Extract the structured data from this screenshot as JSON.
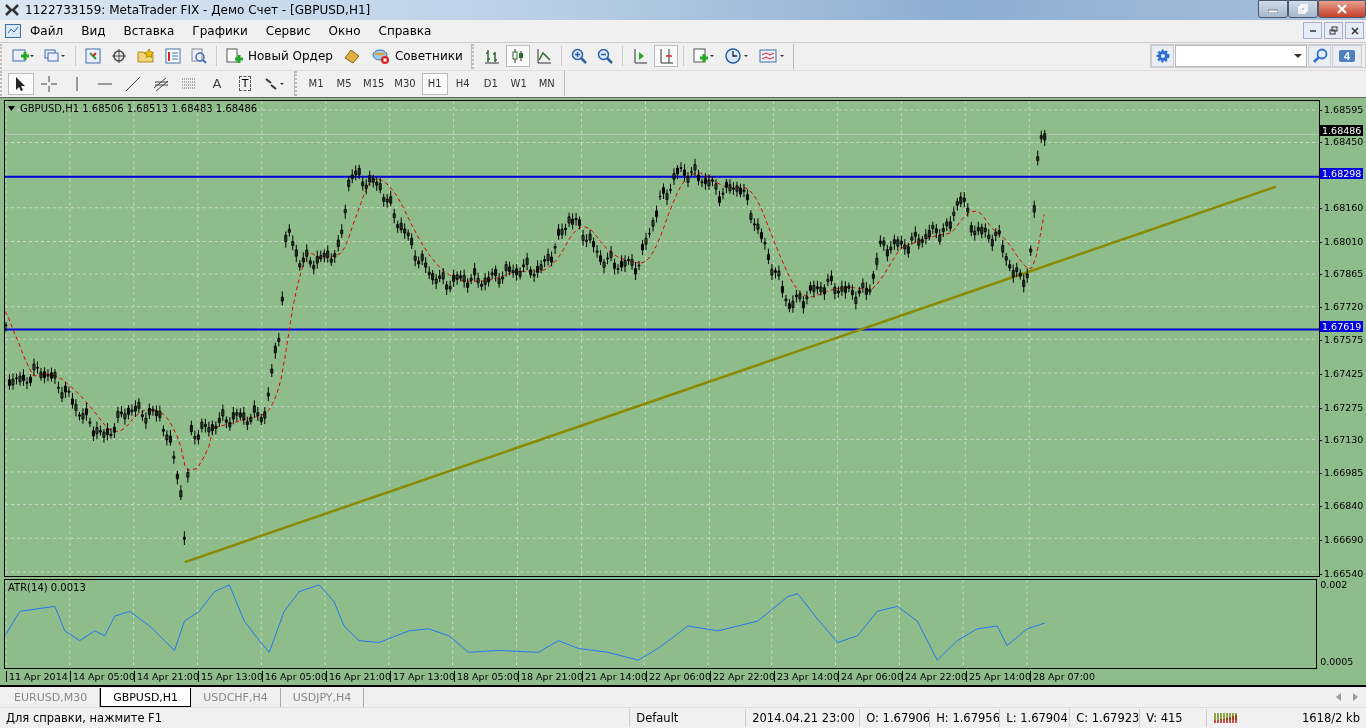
{
  "window": {
    "title": "1122733159: MetaTrader FIX - Демо Счет - [GBPUSD,H1]"
  },
  "menu": [
    "Файл",
    "Вид",
    "Вставка",
    "Графики",
    "Сервис",
    "Окно",
    "Справка"
  ],
  "toolbar": {
    "new_order": "Новый Ордер",
    "experts": "Советники",
    "notifications": "4"
  },
  "tools": [
    {
      "kind": "cursor",
      "selected": true
    },
    {
      "kind": "crosshair",
      "selected": false
    },
    {
      "kind": "vline",
      "selected": false
    },
    {
      "kind": "hline",
      "selected": false
    },
    {
      "kind": "trend",
      "selected": false
    },
    {
      "kind": "fibo",
      "selected": false
    },
    {
      "kind": "channel",
      "selected": false
    },
    {
      "kind": "text",
      "label": "A",
      "selected": false
    },
    {
      "kind": "label",
      "label": "T",
      "selected": false
    },
    {
      "kind": "arrows",
      "selected": false
    }
  ],
  "timeframes": [
    {
      "label": "M1",
      "selected": false
    },
    {
      "label": "M5",
      "selected": false
    },
    {
      "label": "M15",
      "selected": false
    },
    {
      "label": "M30",
      "selected": false
    },
    {
      "label": "H1",
      "selected": true
    },
    {
      "label": "H4",
      "selected": false
    },
    {
      "label": "D1",
      "selected": false
    },
    {
      "label": "W1",
      "selected": false
    },
    {
      "label": "MN",
      "selected": false
    }
  ],
  "chart": {
    "header": "GBPUSD,H1  1.68506 1.68513 1.68483 1.68486",
    "price_ticks": [
      "1.68595",
      "1.68450",
      "1.68160",
      "1.68010",
      "1.67865",
      "1.67720",
      "1.67575",
      "1.67425",
      "1.67275",
      "1.67130",
      "1.66985",
      "1.66840",
      "1.66690",
      "1.66540"
    ],
    "price_markers": [
      {
        "value": "1.68486",
        "kind": "bid"
      },
      {
        "value": "1.68298",
        "kind": "line"
      },
      {
        "value": "1.67619",
        "kind": "line"
      }
    ],
    "indicator": {
      "label": "ATR(14) 0.0013",
      "ticks": [
        "0.002",
        "0.0005"
      ]
    },
    "time_labels": [
      "11 Apr 2014",
      "14 Apr 05:00",
      "14 Apr 21:00",
      "15 Apr 13:00",
      "16 Apr 05:00",
      "16 Apr 21:00",
      "17 Apr 13:00",
      "18 Apr 05:00",
      "18 Apr 21:00",
      "21 Apr 14:00",
      "22 Apr 06:00",
      "22 Apr 22:00",
      "23 Apr 14:00",
      "24 Apr 06:00",
      "24 Apr 22:00",
      "25 Apr 14:00",
      "28 Apr 07:00"
    ]
  },
  "chart_tabs": [
    {
      "label": "EURUSD,M30",
      "selected": false
    },
    {
      "label": "GBPUSD,H1",
      "selected": true
    },
    {
      "label": "USDCHF,H4",
      "selected": false
    },
    {
      "label": "USDJPY,H4",
      "selected": false
    }
  ],
  "status_bar": {
    "help": "Для справки, нажмите F1",
    "profile": "Default",
    "time": "2014.04.21 23:00",
    "open": "O: 1.67906",
    "high": "H: 1.67956",
    "low": "L: 1.67904",
    "close": "C: 1.67923",
    "volume": "V: 415",
    "traffic": "1618/2 kb"
  }
}
